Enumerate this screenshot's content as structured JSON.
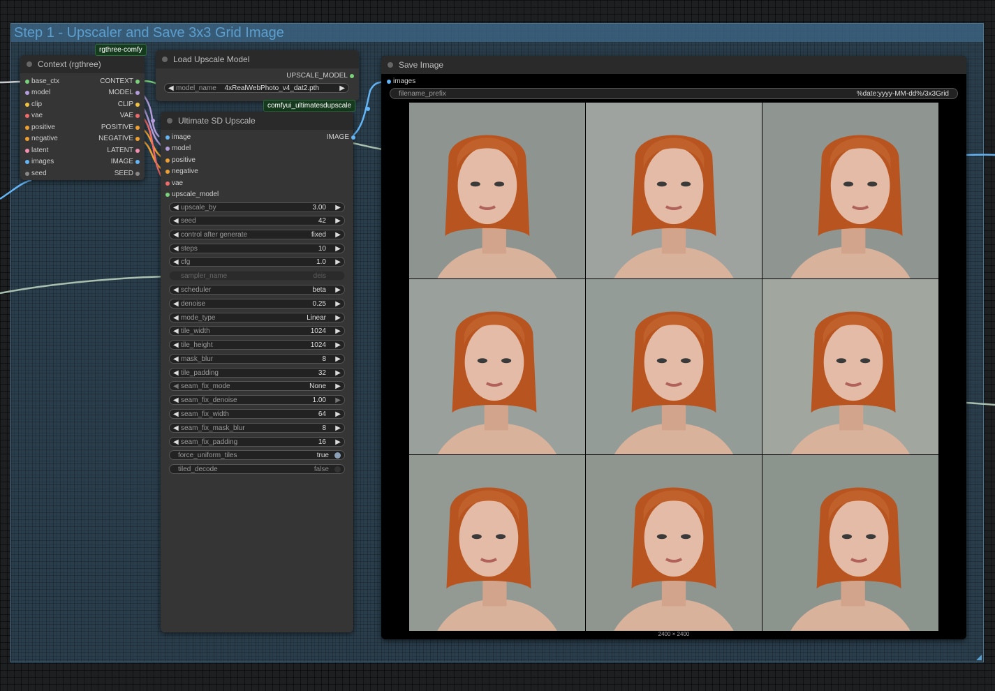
{
  "group": {
    "title": "Step 1 - Upscaler and Save 3x3 Grid Image"
  },
  "badges": {
    "rgthree": "rgthree-comfy",
    "ultimate": "comfyui_ultimatesdupscale"
  },
  "colors": {
    "context": "#7bd07b",
    "model": "#b39ddb",
    "clip": "#f0c040",
    "vae": "#ef6b6b",
    "conditioning": "#f0a030",
    "latent": "#f48fb1",
    "image": "#64b5f6",
    "seed": "#888888",
    "upscale_model": "#7bd07b"
  },
  "context_node": {
    "title": "Context (rgthree)",
    "inputs": [
      "base_ctx",
      "model",
      "clip",
      "vae",
      "positive",
      "negative",
      "latent",
      "images",
      "seed"
    ],
    "outputs": [
      "CONTEXT",
      "MODEL",
      "CLIP",
      "VAE",
      "POSITIVE",
      "NEGATIVE",
      "LATENT",
      "IMAGE",
      "SEED"
    ]
  },
  "load_upscale_node": {
    "title": "Load Upscale Model",
    "output": "UPSCALE_MODEL",
    "widget_label": "model_name",
    "widget_value": "4xRealWebPhoto_v4_dat2.pth"
  },
  "ultimate_node": {
    "title": "Ultimate SD Upscale",
    "inputs": [
      "image",
      "model",
      "positive",
      "negative",
      "vae",
      "upscale_model"
    ],
    "output": "IMAGE",
    "widgets": [
      {
        "label": "upscale_by",
        "value": "3.00"
      },
      {
        "label": "seed",
        "value": "42"
      },
      {
        "label": "control after generate",
        "value": "fixed"
      },
      {
        "label": "steps",
        "value": "10"
      },
      {
        "label": "cfg",
        "value": "1.0"
      },
      {
        "label": "sampler_name",
        "value": "deis"
      },
      {
        "label": "scheduler",
        "value": "beta"
      },
      {
        "label": "denoise",
        "value": "0.25"
      },
      {
        "label": "mode_type",
        "value": "Linear"
      },
      {
        "label": "tile_width",
        "value": "1024"
      },
      {
        "label": "tile_height",
        "value": "1024"
      },
      {
        "label": "mask_blur",
        "value": "8"
      },
      {
        "label": "tile_padding",
        "value": "32"
      },
      {
        "label": "seam_fix_mode",
        "value": "None"
      },
      {
        "label": "seam_fix_denoise",
        "value": "1.00"
      },
      {
        "label": "seam_fix_width",
        "value": "64"
      },
      {
        "label": "seam_fix_mask_blur",
        "value": "8"
      },
      {
        "label": "seam_fix_padding",
        "value": "16"
      }
    ],
    "toggles": [
      {
        "label": "force_uniform_tiles",
        "value": "true"
      },
      {
        "label": "tiled_decode",
        "value": "false"
      }
    ]
  },
  "save_node": {
    "title": "Save Image",
    "input": "images",
    "prefix_label": "filename_prefix",
    "prefix_value": "%date:yyyy-MM-dd%/3x3Grid",
    "dimensions": "2400 × 2400"
  }
}
